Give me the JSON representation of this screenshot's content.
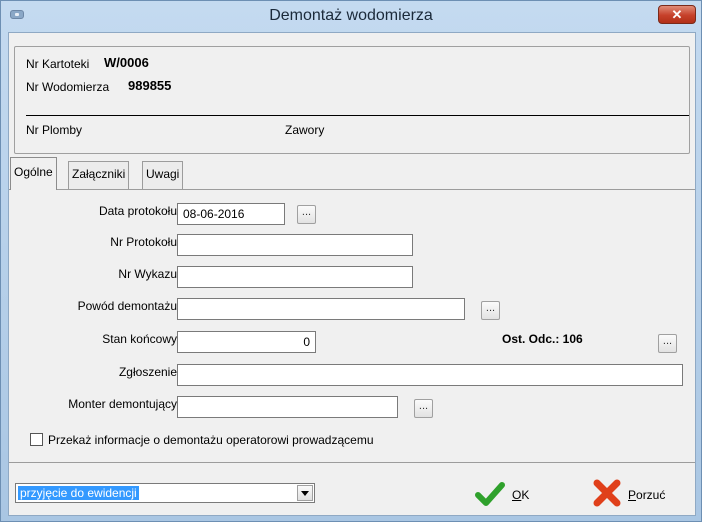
{
  "window": {
    "title": "Demontaż wodomierza",
    "close_glyph": "✕"
  },
  "info": {
    "kartoteka_label": "Nr Kartoteki",
    "kartoteka_value": "W/0006",
    "wodomierz_label": "Nr Wodomierza",
    "wodomierz_value": "989855",
    "plomby_label": "Nr Plomby",
    "zawory_label": "Zawory"
  },
  "tabs": [
    {
      "label": "Ogólne",
      "active": true
    },
    {
      "label": "Załączniki",
      "active": false
    },
    {
      "label": "Uwagi",
      "active": false
    }
  ],
  "form": {
    "data_protokolu": {
      "label": "Data protokołu",
      "value": "08-06-2016"
    },
    "nr_protokolu": {
      "label": "Nr Protokołu",
      "value": ""
    },
    "nr_wykazu": {
      "label": "Nr Wykazu",
      "value": ""
    },
    "powod": {
      "label": "Powód demontażu",
      "value": ""
    },
    "stan": {
      "label": "Stan końcowy",
      "value": "0"
    },
    "ost_odc": "Ost. Odc.: 106",
    "zgloszenie": {
      "label": "Zgłoszenie",
      "value": ""
    },
    "monter": {
      "label": "Monter demontujący",
      "value": ""
    },
    "dots": "...",
    "checkbox_label": "Przekaż informacje o demontażu operatorowi prowadzącemu",
    "checkbox_checked": false
  },
  "footer": {
    "select_value": "przyjęcie do ewidencji",
    "ok_accel": "O",
    "ok_rest": "K",
    "cancel_accel": "P",
    "cancel_rest": "orzuć"
  },
  "colors": {
    "ok_check": "#2fa12c",
    "cancel_x": "#e0401a",
    "selection": "#3399ff"
  }
}
